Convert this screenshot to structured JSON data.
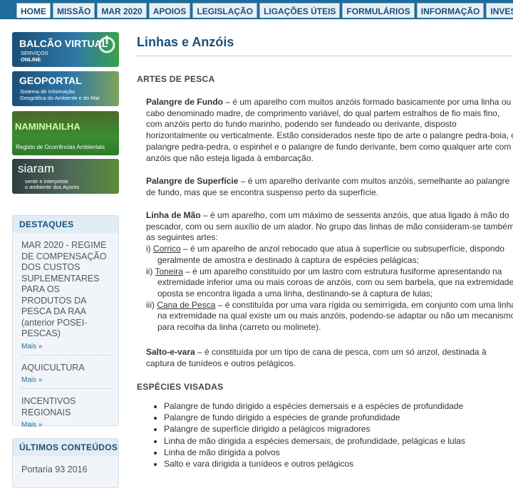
{
  "nav": {
    "tabs": [
      "HOME",
      "MISSÃO",
      "MAR 2020",
      "APOIOS",
      "LEGISLAÇÃO",
      "LIGAÇÕES ÚTEIS",
      "FORMULÁRIOS",
      "INFORMAÇÃO",
      "INVESTIGAÇÃO"
    ]
  },
  "banners": {
    "balcao": {
      "title": "BALCÃO VIRTUAL",
      "sub1": "SERVIÇOS",
      "sub2": "ONLINE"
    },
    "geoportal": {
      "title": "GEOPORTAL",
      "sub1": "Sistema de Informação",
      "sub2": "Geográfica do Ambiente e do Mar"
    },
    "naminhailha": {
      "title": "NAMINHAILHA",
      "sub": "Registo de Ocorrências Ambientais"
    },
    "siaram": {
      "title": "siaram",
      "sub1": "sentir e interpretar",
      "sub2": "o ambiente dos Açores"
    }
  },
  "destaques": {
    "title": "DESTAQUES",
    "items": [
      {
        "title": "MAR 2020 - REGIME DE COMPENSAÇÃO DOS CUSTOS SUPLEMENTARES PARA OS PRODUTOS DA PESCA DA RAA (anterior POSEI-PESCAS)",
        "more": "Mais »"
      },
      {
        "title": "AQUICULTURA",
        "more": "Mais »"
      },
      {
        "title": "INCENTIVOS REGIONAIS",
        "more": "Mais »"
      }
    ]
  },
  "ultimos": {
    "title": "ÚLTIMOS CONTEÚDOS",
    "first": "Portaria 93 2016"
  },
  "content": {
    "title": "Linhas e Anzóis",
    "section1": "ARTES DE PESCA",
    "p1_term": "Palangre de Fundo",
    "p1_text": " – é um aparelho com muitos anzóis formado basicamente por uma linha ou cabo denominado madre, de comprimento variável, do qual partem estralhos de fio mais fino, com anzóis perto do fundo marinho, podendo ser fundeado ou derivante, disposto horizontalmente ou verticalmente. Estão considerados neste tipo de arte o palangre pedra-boia, o palangre pedra-pedra, o espinhel e o palangre de fundo derivante, bem como qualquer arte com anzóis que não esteja ligada à embarcação.",
    "p2_term": "Palangre de Superfície",
    "p2_text": " – é um aparelho derivante com muitos anzóis, semelhante ao palangre de fundo, mas que se encontra suspenso perto da superfície.",
    "p3_term": "Linha de Mão",
    "p3_text": " – é um aparelho, com um máximo de sessenta anzóis, que atua ligado à mão do pescador, com ou sem auxílio de um alador. No grupo das linhas de mão consideram-se também as seguintes artes:",
    "s1_prefix": "i) ",
    "s1_term": "Corrico",
    "s1_text": " – é um aparelho de anzol rebocado que atua à superfície ou subsuperfície, dispondo geralmente de amostra e destinado à captura de espécies pelágicas;",
    "s2_prefix": "ii) ",
    "s2_term": "Toneira",
    "s2_text": " – é um aparelho constituído por um lastro com estrutura fusiforme apresentando na extremidade inferior uma ou mais coroas de anzóis, com ou sem barbela, que na extremidade oposta se encontra ligada a uma linha, destinando-se à captura de lulas;",
    "s3_prefix": "iii) ",
    "s3_term": "Cana de Pesca",
    "s3_text": " – é constituída por uma vara rígida ou semirrígida, em conjunto com uma linha na extremidade na qual existe um ou mais anzóis, podendo-se adaptar ou não um mecanismo para recolha da linha (carreto ou molinete).",
    "p4_term": "Salto-e-vara",
    "p4_text": " – é constituída por um tipo de cana de pesca, com um só anzol, destinada à captura de tunídeos e outros pelágicos.",
    "section2": "ESPÉCIES VISADAS",
    "species": [
      "Palangre de fundo dirigido a espécies demersais e a espécies de profundidade",
      "Palangre de fundo dirigido a espécies de grande profundidade",
      "Palangre de superfície dirigido a pelágicos migradores",
      "Linha de mão dirigida a espécies demersais, de profundidade, pelágicas e lulas",
      "Linha de mão dirigida a polvos",
      "Salto e vara dirigida a tunídeos e outros pelágicos"
    ]
  }
}
